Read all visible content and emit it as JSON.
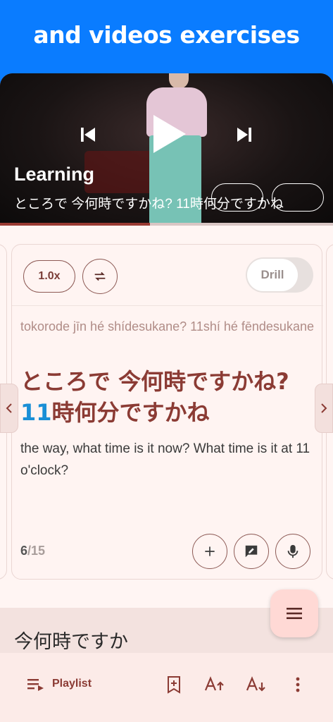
{
  "banner": {
    "text": "and videos exercises"
  },
  "video": {
    "title": "Learning",
    "subtitle": "ところで 今何時ですかね?  11時何分ですかね",
    "progress": 0.45
  },
  "card": {
    "speed_label": "1.0x",
    "drill_label": "Drill",
    "romaji": "tokorode jīn hé shídesukane?  11shí hé fēndesukane",
    "jp_line1": "ところで 今何時ですかね?",
    "jp_num": "11",
    "jp_line2_rest": "時何分ですかね",
    "translation": "the way, what time is it now? What time is it at 11 o'clock?",
    "counter_current": "6",
    "counter_total": "/15"
  },
  "bottom": {
    "title": "今何時ですか",
    "playlist_label": "Playlist"
  }
}
